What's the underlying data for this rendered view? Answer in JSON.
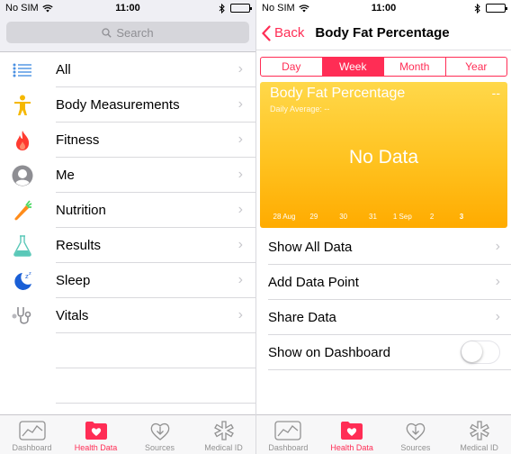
{
  "left": {
    "status": {
      "carrier": "No SIM",
      "time": "11:00"
    },
    "search": {
      "placeholder": "Search"
    },
    "menu": [
      {
        "label": "All",
        "icon": "list-icon"
      },
      {
        "label": "Body Measurements",
        "icon": "body-figure-icon"
      },
      {
        "label": "Fitness",
        "icon": "flame-icon"
      },
      {
        "label": "Me",
        "icon": "person-silhouette-icon"
      },
      {
        "label": "Nutrition",
        "icon": "carrot-icon"
      },
      {
        "label": "Results",
        "icon": "flask-icon"
      },
      {
        "label": "Sleep",
        "icon": "moon-icon"
      },
      {
        "label": "Vitals",
        "icon": "stethoscope-icon"
      }
    ],
    "tabs": [
      {
        "label": "Dashboard",
        "icon": "dashboard-chart-icon",
        "active": false
      },
      {
        "label": "Health Data",
        "icon": "health-folder-icon",
        "active": true
      },
      {
        "label": "Sources",
        "icon": "sources-heart-icon",
        "active": false
      },
      {
        "label": "Medical ID",
        "icon": "medical-star-icon",
        "active": false
      }
    ]
  },
  "right": {
    "status": {
      "carrier": "No SIM",
      "time": "11:00"
    },
    "nav": {
      "back_label": "Back",
      "title": "Body Fat Percentage"
    },
    "segments": [
      {
        "label": "Day",
        "active": false
      },
      {
        "label": "Week",
        "active": true
      },
      {
        "label": "Month",
        "active": false
      },
      {
        "label": "Year",
        "active": false
      }
    ],
    "chart": {
      "title": "Body Fat Percentage",
      "value": "--",
      "subtitle": "Daily Average: --",
      "empty_text": "No Data",
      "x_labels": [
        "28 Aug",
        "29",
        "30",
        "31",
        "1 Sep",
        "2",
        "3"
      ],
      "highlighted_label": "3"
    },
    "actions": [
      {
        "label": "Show All Data",
        "kind": "chevron"
      },
      {
        "label": "Add Data Point",
        "kind": "chevron"
      },
      {
        "label": "Share Data",
        "kind": "chevron"
      },
      {
        "label": "Show on Dashboard",
        "kind": "toggle",
        "on": false
      }
    ],
    "tabs": [
      {
        "label": "Dashboard",
        "icon": "dashboard-chart-icon",
        "active": false
      },
      {
        "label": "Health Data",
        "icon": "health-folder-icon",
        "active": true
      },
      {
        "label": "Sources",
        "icon": "sources-heart-icon",
        "active": false
      },
      {
        "label": "Medical ID",
        "icon": "medical-star-icon",
        "active": false
      }
    ]
  },
  "colors": {
    "accent": "#ff2d55",
    "chart_top": "#ffd84a",
    "chart_bottom": "#ffab00",
    "chevron": "#c7c7cc",
    "tab_inactive": "#929292"
  }
}
